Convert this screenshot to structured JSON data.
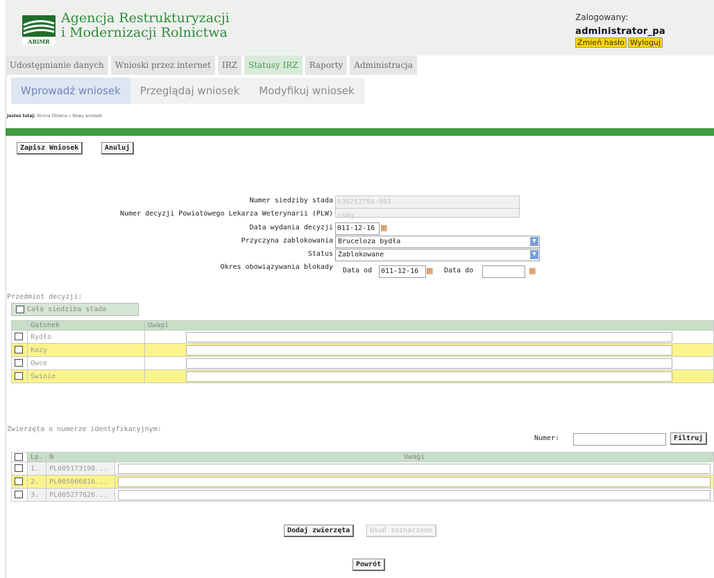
{
  "header": {
    "agency_line1": "Agencja Restrukturyzacji",
    "agency_line2": "i Modernizacji Rolnictwa",
    "logo_text": "ARiMR",
    "logged_label": "Zalogowany:",
    "username": "administrator_pa",
    "change_password": "Zmień hasło",
    "logout": "Wyloguj"
  },
  "menu1": [
    "Udostępnianie danych",
    "Wnioski przez internet",
    "IRZ",
    "Statusy IRZ",
    "Raporty",
    "Administracja"
  ],
  "menu2": [
    "Wprowadź wniosek",
    "Przeglądaj wniosek",
    "Modyfikuj wniosek"
  ],
  "breadcrumb": {
    "label": "Jesteś tutaj:",
    "path": "Strona Główna » Nowy wniosek"
  },
  "actions": {
    "save": "Zapisz Wniosek",
    "cancel": "Anuluj"
  },
  "form": {
    "herd_label": "Numer siedziby stada",
    "herd_value": "036252795-001",
    "plw_label": "Numer decyzji Powiatowego Lekarza Weterynarii (PLW)",
    "plw_value": "ssdg",
    "date_label": "Data wydania decyzji",
    "date_value": "011-12-16",
    "reason_label": "Przyczyna zablokowania",
    "reason_value": "Bruceloza bydła",
    "status_label": "Status",
    "status_value": "Zablokowane",
    "period_label": "Okres obowiązywania blokady",
    "from_label": "Data od",
    "from_value": "011-12-16",
    "to_label": "Data do",
    "to_value": ""
  },
  "subject": {
    "label": "Przedmiot decyzji:",
    "whole_herd": "Cała siedziba stada",
    "columns": [
      "Gatunek",
      "Uwagi"
    ],
    "rows": [
      "Bydło",
      "Kozy",
      "Owce",
      "Świnie"
    ]
  },
  "animals": {
    "label": "Zwierzęta o numerze identyfikacyjnym:",
    "number_label": "Numer:",
    "filter": "Filtruj",
    "columns": [
      "Lp.",
      "N",
      "Uwagi"
    ],
    "rows": [
      {
        "lp": "1.",
        "num": "PL005173198..."
      },
      {
        "lp": "2.",
        "num": "PL005006816..."
      },
      {
        "lp": "3.",
        "num": "PL005277626..."
      }
    ]
  },
  "bottom": {
    "add": "Dodaj zwierzęta",
    "remove": "Usuń zaznaczone",
    "back": "Powrót"
  }
}
